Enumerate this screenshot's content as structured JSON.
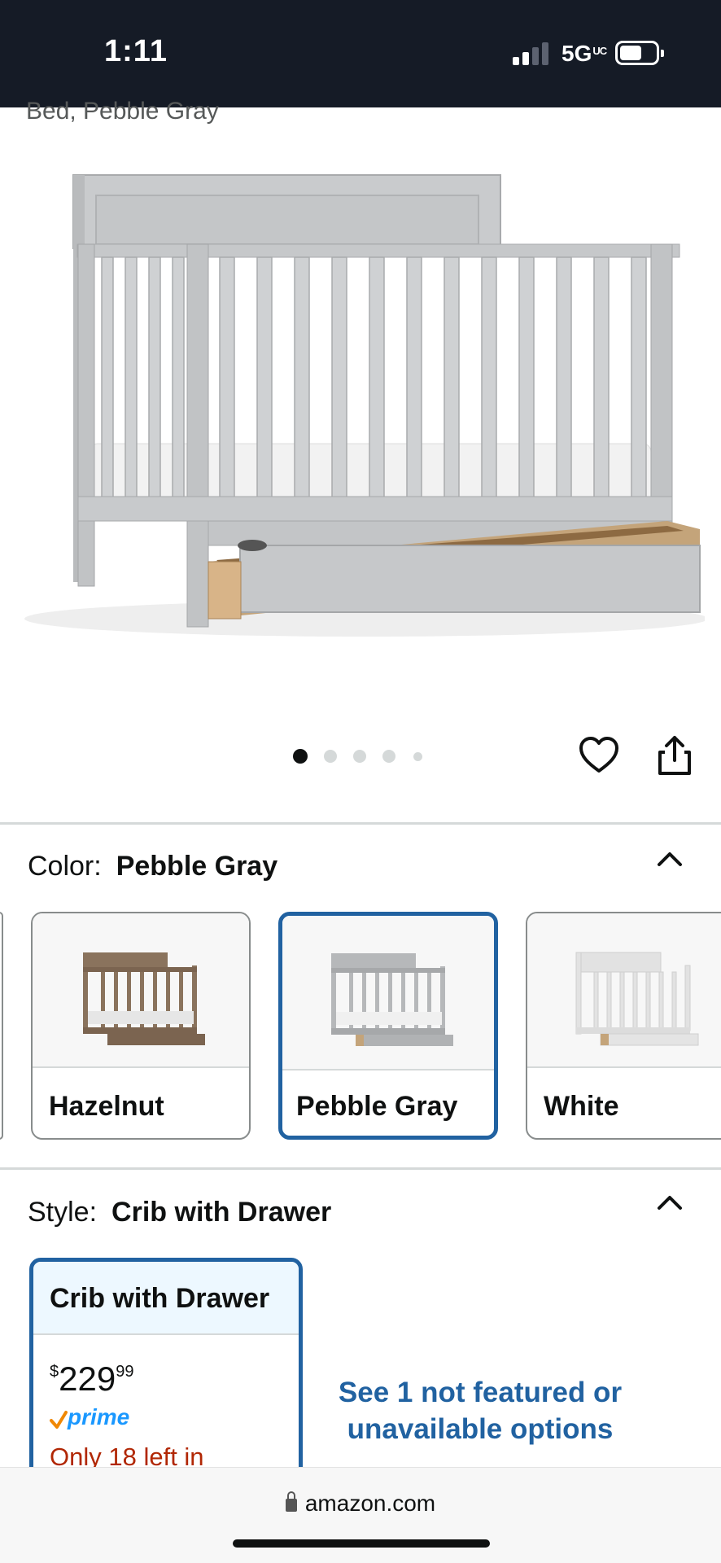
{
  "status_bar": {
    "time": "1:11",
    "network": "5G",
    "network_sup": "UC",
    "icons": [
      "signal-icon",
      "battery-icon"
    ]
  },
  "product": {
    "title_fragment": "Bed, Pebble Gray",
    "image_dots": {
      "count": 5,
      "active_index": 0
    },
    "actions": [
      "heart-icon",
      "share-icon"
    ]
  },
  "color": {
    "label": "Color:",
    "selected": "Pebble Gray",
    "options": [
      {
        "name": "Hazelnut",
        "tint": "#8a735d"
      },
      {
        "name": "Pebble Gray",
        "tint": "#b6b8ba"
      },
      {
        "name": "White",
        "tint": "#ededed"
      }
    ]
  },
  "style": {
    "label": "Style:",
    "selected": "Crib with Drawer",
    "card": {
      "title": "Crib with Drawer",
      "price_symbol": "$",
      "price_whole": "229",
      "price_fraction": "99",
      "prime_label": "prime",
      "stock": "Only 18 left in"
    },
    "see_more": "See 1 not featured or unavailable options"
  },
  "browser": {
    "url": "amazon.com"
  },
  "colors": {
    "accent": "#2162a1",
    "status_bar_bg": "#151b26",
    "prime_blue": "#1a98ff",
    "prime_check": "#f08804",
    "stock_red": "#b12704"
  }
}
